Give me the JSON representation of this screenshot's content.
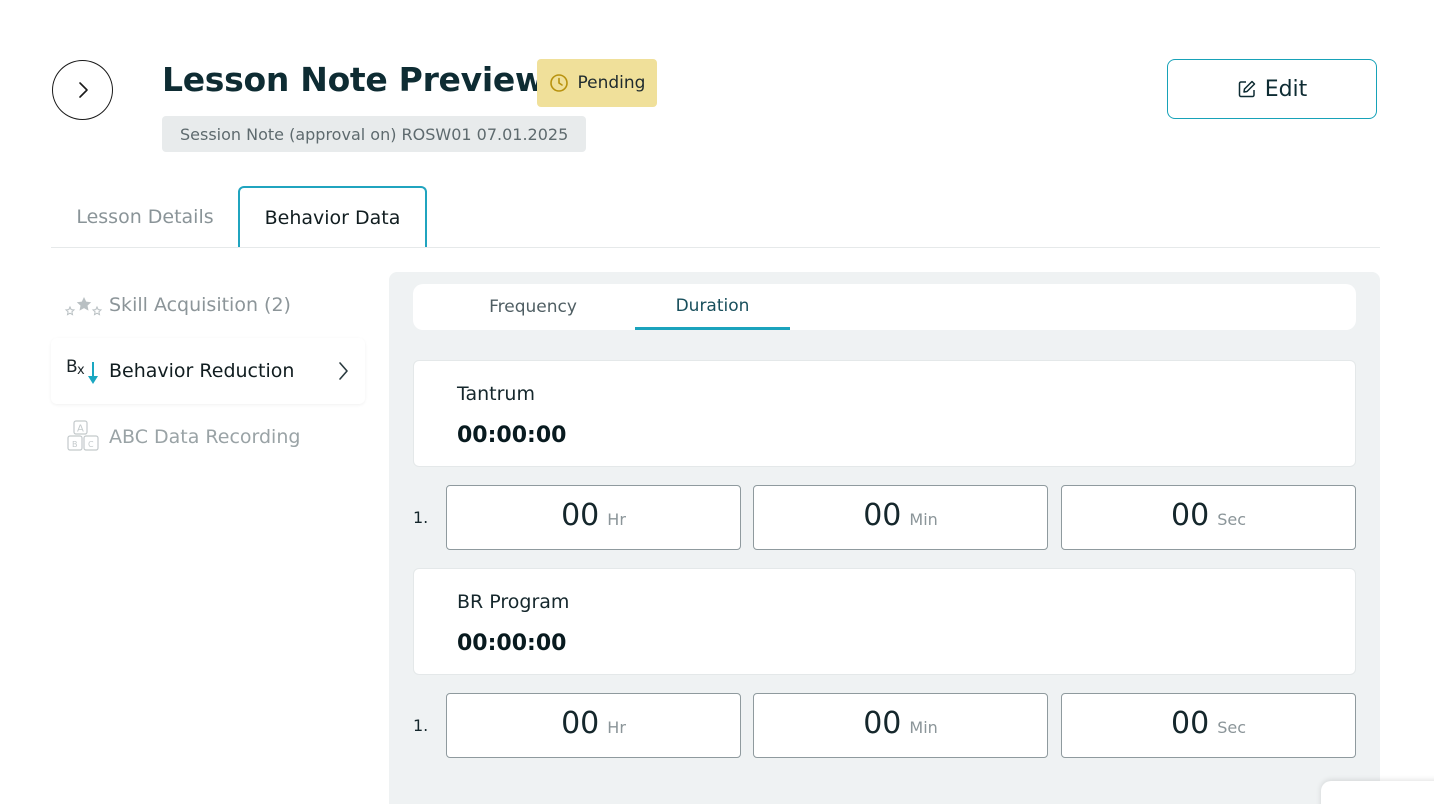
{
  "header": {
    "title": "Lesson Note Preview",
    "status": "Pending",
    "subtitle": "Session Note (approval on) ROSW01 07.01.2025",
    "edit_label": "Edit"
  },
  "tabs": [
    {
      "label": "Lesson Details",
      "active": false
    },
    {
      "label": "Behavior Data",
      "active": true
    }
  ],
  "sidebar": {
    "items": [
      {
        "label": "Skill Acquisition (2)",
        "icon": "stars-icon",
        "active": false
      },
      {
        "label": "Behavior Reduction",
        "icon": "behavior-reduction-icon",
        "active": true
      },
      {
        "label": "ABC Data Recording",
        "icon": "abc-blocks-icon",
        "active": false
      }
    ]
  },
  "subtabs": [
    {
      "label": "Frequency",
      "active": false
    },
    {
      "label": "Duration",
      "active": true
    }
  ],
  "behaviors": [
    {
      "name": "Tantrum",
      "total": "00:00:00",
      "entries": [
        {
          "index": "1.",
          "hr": "00",
          "min": "00",
          "sec": "00"
        }
      ]
    },
    {
      "name": "BR Program",
      "total": "00:00:00",
      "entries": [
        {
          "index": "1.",
          "hr": "00",
          "min": "00",
          "sec": "00"
        }
      ]
    }
  ],
  "units": {
    "hr": "Hr",
    "min": "Min",
    "sec": "Sec"
  },
  "colors": {
    "accent": "#1ba3bd",
    "pending_bg": "#f0e09a",
    "panel_bg": "#eff2f3",
    "title": "#0e2c33"
  }
}
